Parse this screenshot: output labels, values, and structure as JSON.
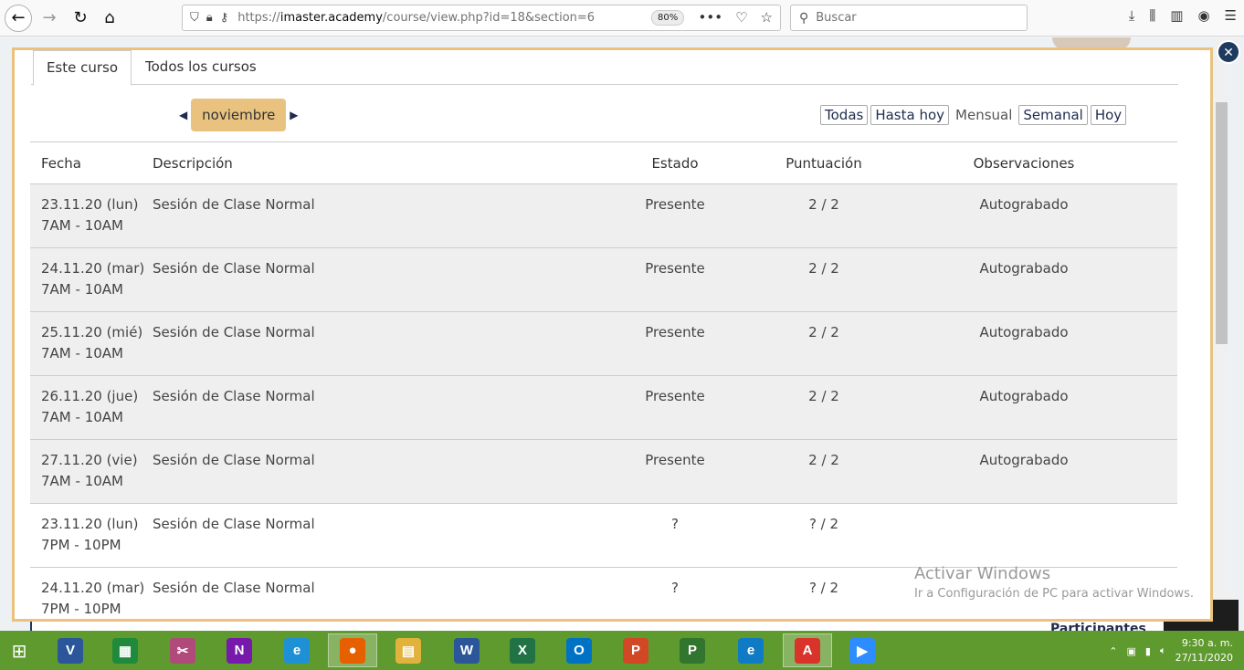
{
  "browser": {
    "url_scheme": "https://",
    "url_domain": "imaster.academy",
    "url_path": "/course/view.php?id=18&section=6",
    "zoom": "80%",
    "search_placeholder": "Buscar"
  },
  "tabs": [
    {
      "label": "Este curso"
    },
    {
      "label": "Todos los cursos"
    }
  ],
  "month_nav": {
    "month": "noviembre",
    "prev": "◀",
    "next": "▶"
  },
  "view_options": {
    "all": "Todas",
    "until_today": "Hasta hoy",
    "monthly": "Mensual",
    "weekly": "Semanal",
    "today": "Hoy"
  },
  "table": {
    "headers": {
      "date": "Fecha",
      "description": "Descripción",
      "status": "Estado",
      "score": "Puntuación",
      "notes": "Observaciones"
    },
    "rows": [
      {
        "date": "23.11.20 (lun)",
        "time": "7AM - 10AM",
        "description": "Sesión de Clase Normal",
        "status": "Presente",
        "score": "2 / 2",
        "notes": "Autograbado"
      },
      {
        "date": "24.11.20 (mar)",
        "time": "7AM - 10AM",
        "description": "Sesión de Clase Normal",
        "status": "Presente",
        "score": "2 / 2",
        "notes": "Autograbado"
      },
      {
        "date": "25.11.20 (mié)",
        "time": "7AM - 10AM",
        "description": "Sesión de Clase Normal",
        "status": "Presente",
        "score": "2 / 2",
        "notes": "Autograbado"
      },
      {
        "date": "26.11.20 (jue)",
        "time": "7AM - 10AM",
        "description": "Sesión de Clase Normal",
        "status": "Presente",
        "score": "2 / 2",
        "notes": "Autograbado"
      },
      {
        "date": "27.11.20 (vie)",
        "time": "7AM - 10AM",
        "description": "Sesión de Clase Normal",
        "status": "Presente",
        "score": "2 / 2",
        "notes": "Autograbado"
      },
      {
        "date": "23.11.20 (lun)",
        "time": "7PM - 10PM",
        "description": "Sesión de Clase Normal",
        "status": "?",
        "score": "? / 2",
        "notes": ""
      },
      {
        "date": "24.11.20 (mar)",
        "time": "7PM - 10PM",
        "description": "Sesión de Clase Normal",
        "status": "?",
        "score": "? / 2",
        "notes": ""
      }
    ]
  },
  "watermark": {
    "title": "Activar Windows",
    "subtitle": "Ir a Configuración de PC para activar Windows."
  },
  "behind": {
    "participants": "Participantes"
  },
  "taskbar": {
    "apps": [
      {
        "name": "visio",
        "letter": "V",
        "color": "#2b579a"
      },
      {
        "name": "store",
        "letter": "▦",
        "color": "#1f8a3b"
      },
      {
        "name": "paint",
        "letter": "✂",
        "color": "#b04a7a"
      },
      {
        "name": "onenote",
        "letter": "N",
        "color": "#7719aa"
      },
      {
        "name": "internet-explorer",
        "letter": "e",
        "color": "#1e90d6"
      },
      {
        "name": "firefox",
        "letter": "●",
        "color": "#e66000"
      },
      {
        "name": "file-explorer",
        "letter": "▤",
        "color": "#e2b33c"
      },
      {
        "name": "word",
        "letter": "W",
        "color": "#2b579a"
      },
      {
        "name": "excel",
        "letter": "X",
        "color": "#217346"
      },
      {
        "name": "outlook",
        "letter": "O",
        "color": "#0072c6"
      },
      {
        "name": "powerpoint",
        "letter": "P",
        "color": "#d24726"
      },
      {
        "name": "project",
        "letter": "P",
        "color": "#31752f"
      },
      {
        "name": "edge",
        "letter": "e",
        "color": "#0f7bc4"
      },
      {
        "name": "pdf-reader",
        "letter": "A",
        "color": "#d9342b"
      },
      {
        "name": "zoom",
        "letter": "▶",
        "color": "#2d8cff"
      }
    ],
    "time": "9:30 a. m.",
    "date": "27/11/2020"
  }
}
